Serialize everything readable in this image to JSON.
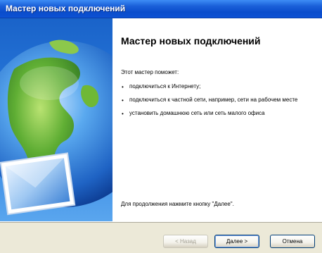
{
  "window": {
    "title": "Мастер новых подключений"
  },
  "content": {
    "heading": "Мастер новых подключений",
    "intro": "Этот мастер поможет:",
    "bullets": [
      "подключиться к Интернету;",
      "подключиться к частной сети, например, сети на рабочем месте",
      "установить домашнюю сеть или сеть малого офиса"
    ],
    "footer": "Для продолжения нажмите кнопку \"Далее\"."
  },
  "buttons": {
    "back": "< Назад",
    "next": "Далее >",
    "cancel": "Отмена"
  },
  "colors": {
    "titlebar": "#0a4ccc",
    "panel": "#2c7fe0",
    "dialog": "#ece9d8"
  }
}
